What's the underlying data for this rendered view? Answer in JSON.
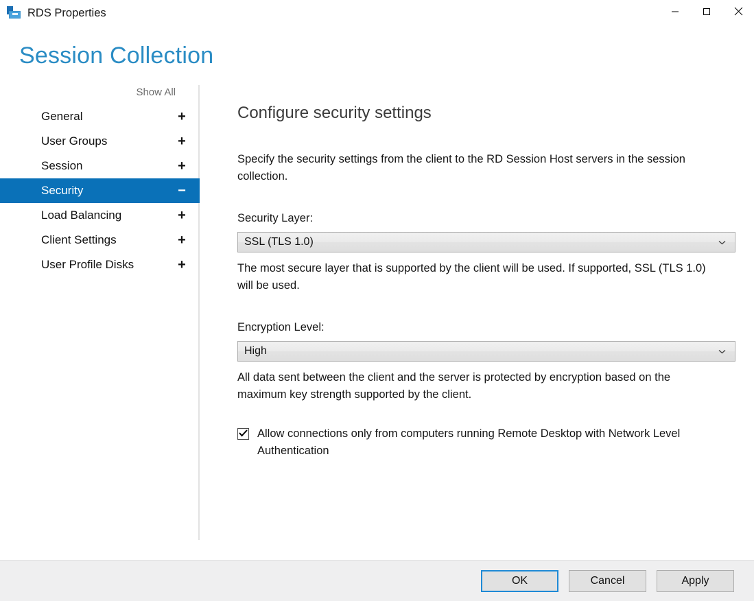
{
  "window": {
    "title": "RDS Properties",
    "icon": "rds-server-icon",
    "controls": {
      "minimize": "minimize-icon",
      "maximize": "maximize-icon",
      "close": "close-icon"
    }
  },
  "header": {
    "title": "Session Collection",
    "color": "#2a8cc4"
  },
  "nav": {
    "show_all_label": "Show All",
    "selected_color": "#0a71b8",
    "items": [
      {
        "label": "General",
        "sign": "+",
        "expanded": false
      },
      {
        "label": "User Groups",
        "sign": "+",
        "expanded": false
      },
      {
        "label": "Session",
        "sign": "+",
        "expanded": false
      },
      {
        "label": "Security",
        "sign": "−",
        "expanded": true
      },
      {
        "label": "Load Balancing",
        "sign": "+",
        "expanded": false
      },
      {
        "label": "Client Settings",
        "sign": "+",
        "expanded": false
      },
      {
        "label": "User Profile Disks",
        "sign": "+",
        "expanded": false
      }
    ]
  },
  "content": {
    "title": "Configure security settings",
    "description": "Specify the security settings from the client to the RD Session Host servers in the session collection.",
    "security_layer": {
      "label": "Security Layer:",
      "value": "SSL (TLS 1.0)",
      "arrow_icon": "chevron-down-icon",
      "helper": "The most secure layer that is supported by the client will be used. If supported, SSL (TLS 1.0) will be used."
    },
    "encryption_level": {
      "label": "Encryption Level:",
      "value": "High",
      "arrow_icon": "chevron-down-icon",
      "helper": "All data sent between the client and the server is protected by encryption based on the maximum key strength supported by the client."
    },
    "nla_checkbox": {
      "label": "Allow connections only from computers running Remote Desktop with Network Level Authentication",
      "checked": true
    }
  },
  "footer": {
    "ok_label": "OK",
    "cancel_label": "Cancel",
    "apply_label": "Apply"
  }
}
